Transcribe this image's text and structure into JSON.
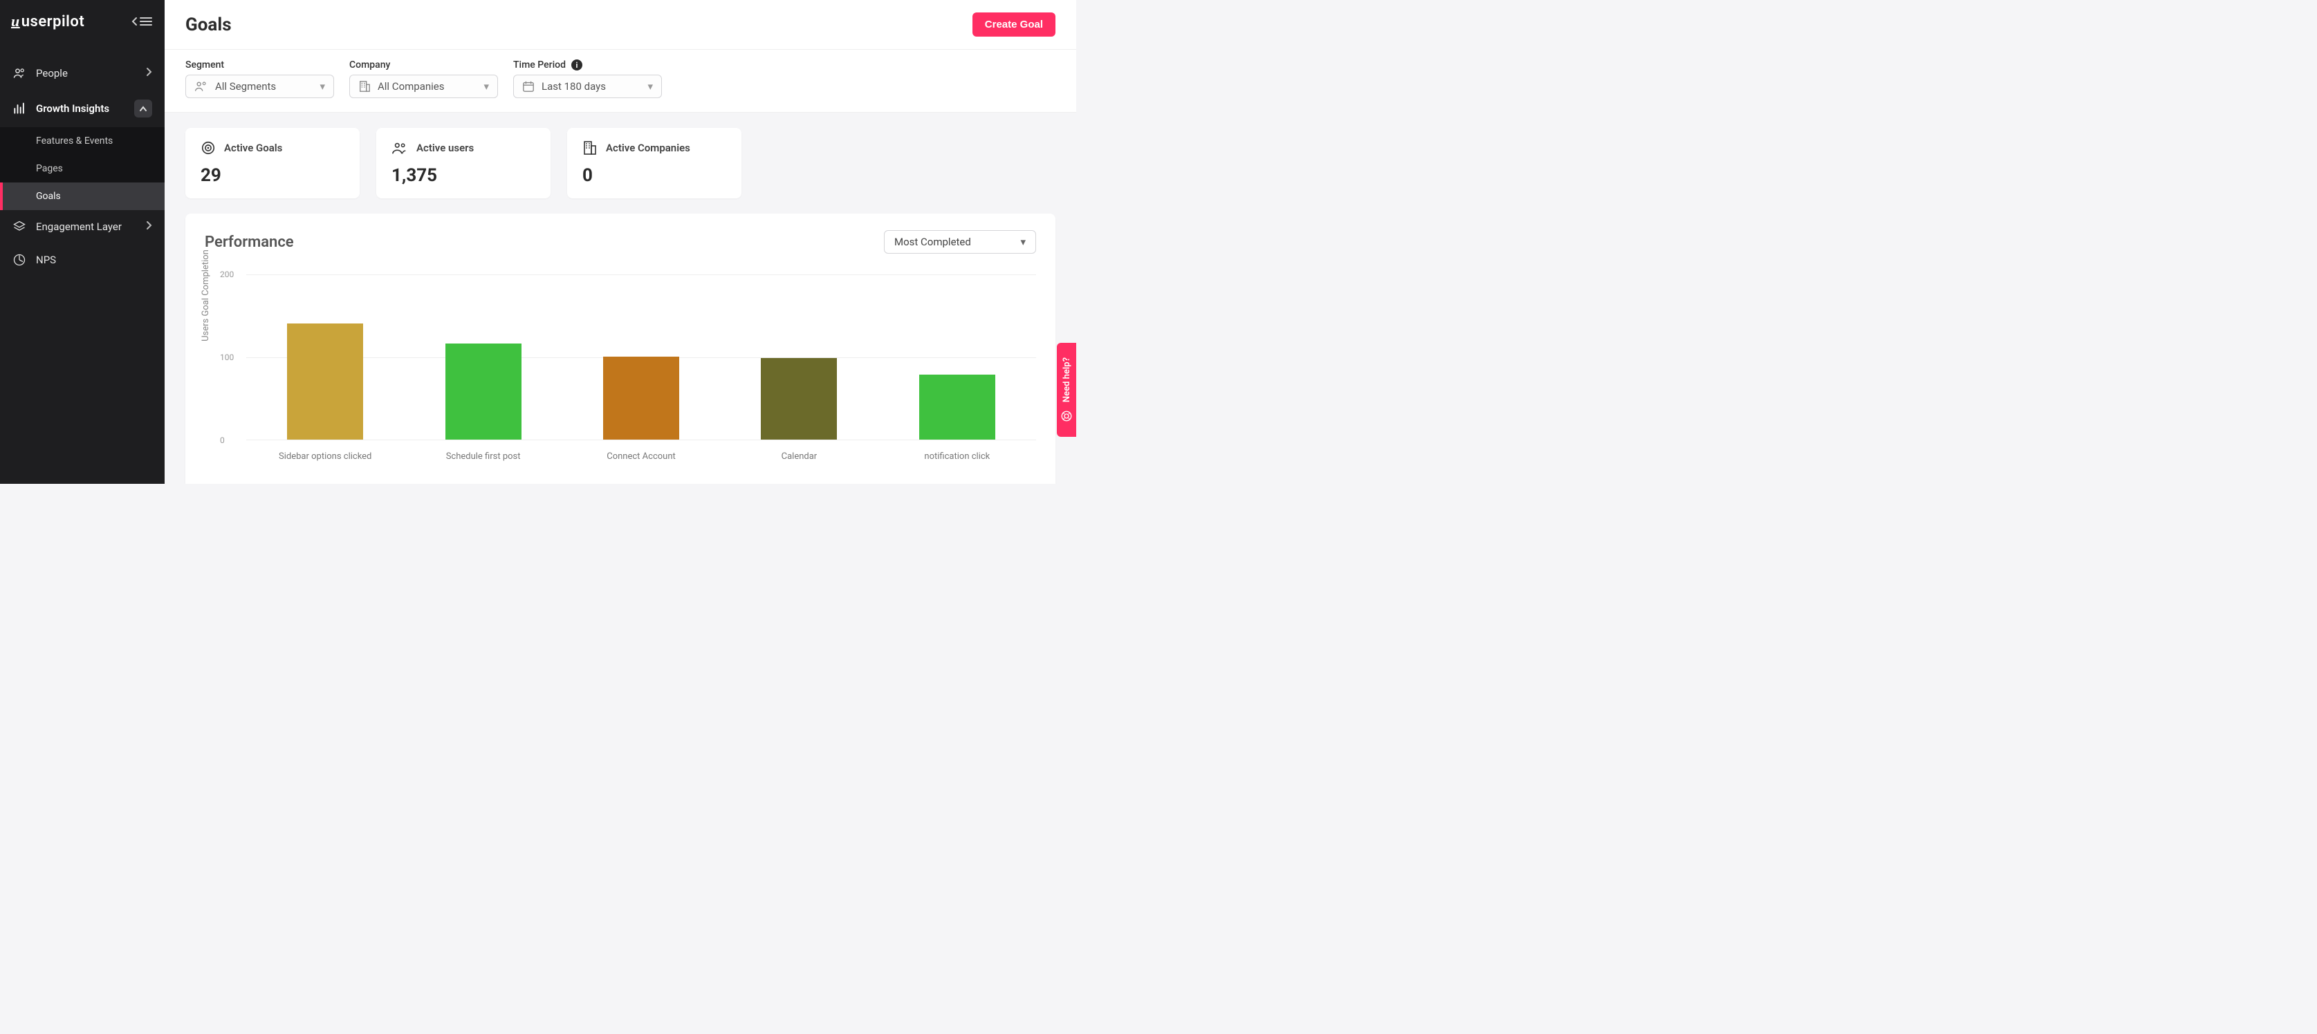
{
  "brand": "userpilot",
  "header": {
    "title": "Goals",
    "primary_button": "Create Goal"
  },
  "sidebar": {
    "items": [
      {
        "label": "People"
      },
      {
        "label": "Growth Insights",
        "children": [
          {
            "label": "Features & Events"
          },
          {
            "label": "Pages"
          },
          {
            "label": "Goals",
            "active": true
          }
        ]
      },
      {
        "label": "Engagement Layer"
      },
      {
        "label": "NPS"
      }
    ]
  },
  "filters": {
    "segment": {
      "label": "Segment",
      "value": "All Segments"
    },
    "company": {
      "label": "Company",
      "value": "All Companies"
    },
    "period": {
      "label": "Time Period",
      "value": "Last 180 days"
    }
  },
  "kpis": {
    "active_goals": {
      "label": "Active Goals",
      "value": "29"
    },
    "active_users": {
      "label": "Active users",
      "value": "1,375"
    },
    "active_companies": {
      "label": "Active Companies",
      "value": "0"
    }
  },
  "performance": {
    "title": "Performance",
    "sort": "Most Completed"
  },
  "help": {
    "label": "Need help?"
  },
  "chart_data": {
    "type": "bar",
    "title": "Performance",
    "xlabel": "",
    "ylabel": "Users Goal Completion",
    "ylim": [
      0,
      200
    ],
    "yticks": [
      0,
      100,
      200
    ],
    "categories": [
      "Sidebar options clicked",
      "Schedule first post",
      "Connect Account",
      "Calendar",
      "notification click"
    ],
    "values": [
      140,
      116,
      100,
      98,
      78
    ],
    "colors": [
      "#c9a43a",
      "#3fc13f",
      "#c1761b",
      "#6b6a2a",
      "#3fc13f"
    ]
  }
}
